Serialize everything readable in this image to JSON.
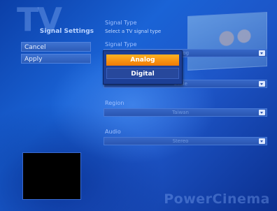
{
  "watermark": "TV",
  "screen_title": "Signal Settings",
  "sidebar": {
    "cancel_label": "Cancel",
    "apply_label": "Apply"
  },
  "section": {
    "title": "Signal Type",
    "subtitle": "Select a TV signal type"
  },
  "signal_type": {
    "label": "Signal Type",
    "value": "Analog"
  },
  "signal_field2": {
    "value": "Cable"
  },
  "region": {
    "label": "Region",
    "value": "Taiwan"
  },
  "audio": {
    "label": "Audio",
    "value": "Stereo"
  },
  "popup": {
    "options": [
      "Analog",
      "Digital"
    ],
    "highlighted": "Analog"
  },
  "brand": "PowerCinema"
}
